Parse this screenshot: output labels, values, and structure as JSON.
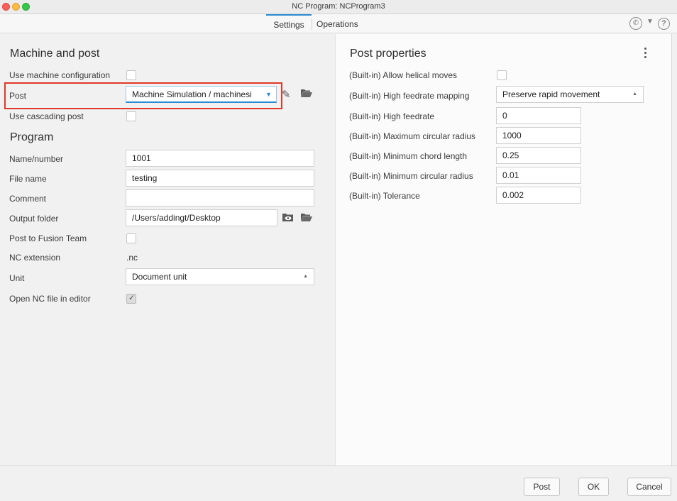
{
  "window": {
    "title": "NC Program: NCProgram3"
  },
  "tabs": [
    {
      "label": "Settings",
      "active": true
    },
    {
      "label": "Operations",
      "active": false
    }
  ],
  "toolbar_icons": [
    "support-phone-icon",
    "chevron-down-icon",
    "help-icon"
  ],
  "machine_and_post": {
    "title": "Machine and post",
    "use_machine_config": {
      "label": "Use machine configuration",
      "checked": false
    },
    "post": {
      "label": "Post",
      "value": "Machine Simulation / machinesi"
    },
    "use_cascading_post": {
      "label": "Use cascading post",
      "checked": false
    }
  },
  "program": {
    "title": "Program",
    "name_number": {
      "label": "Name/number",
      "value": "1001"
    },
    "file_name": {
      "label": "File name",
      "value": "testing"
    },
    "comment": {
      "label": "Comment",
      "value": ""
    },
    "output_folder": {
      "label": "Output folder",
      "value": "/Users/addingt/Desktop"
    },
    "post_to_fusion_team": {
      "label": "Post to Fusion Team",
      "checked": false
    },
    "nc_extension": {
      "label": "NC extension",
      "value": ".nc"
    },
    "unit": {
      "label": "Unit",
      "value": "Document unit"
    },
    "open_nc_file": {
      "label": "Open NC file in editor",
      "checked": true
    }
  },
  "post_properties": {
    "title": "Post properties",
    "allow_helical": {
      "label": "(Built-in) Allow helical moves",
      "checked": false
    },
    "high_feedrate_mapping": {
      "label": "(Built-in) High feedrate mapping",
      "value": "Preserve rapid movement"
    },
    "high_feedrate": {
      "label": "(Built-in) High feedrate",
      "value": "0"
    },
    "max_circular_radius": {
      "label": "(Built-in) Maximum circular radius",
      "value": "1000"
    },
    "min_chord_length": {
      "label": "(Built-in) Minimum chord length",
      "value": "0.25"
    },
    "min_circular_radius": {
      "label": "(Built-in) Minimum circular radius",
      "value": "0.01"
    },
    "tolerance": {
      "label": "(Built-in) Tolerance",
      "value": "0.002"
    }
  },
  "footer": {
    "post_label": "Post",
    "ok_label": "OK",
    "cancel_label": "Cancel"
  },
  "colors": {
    "accent": "#2a8ad4",
    "highlight": "#e03a28"
  }
}
